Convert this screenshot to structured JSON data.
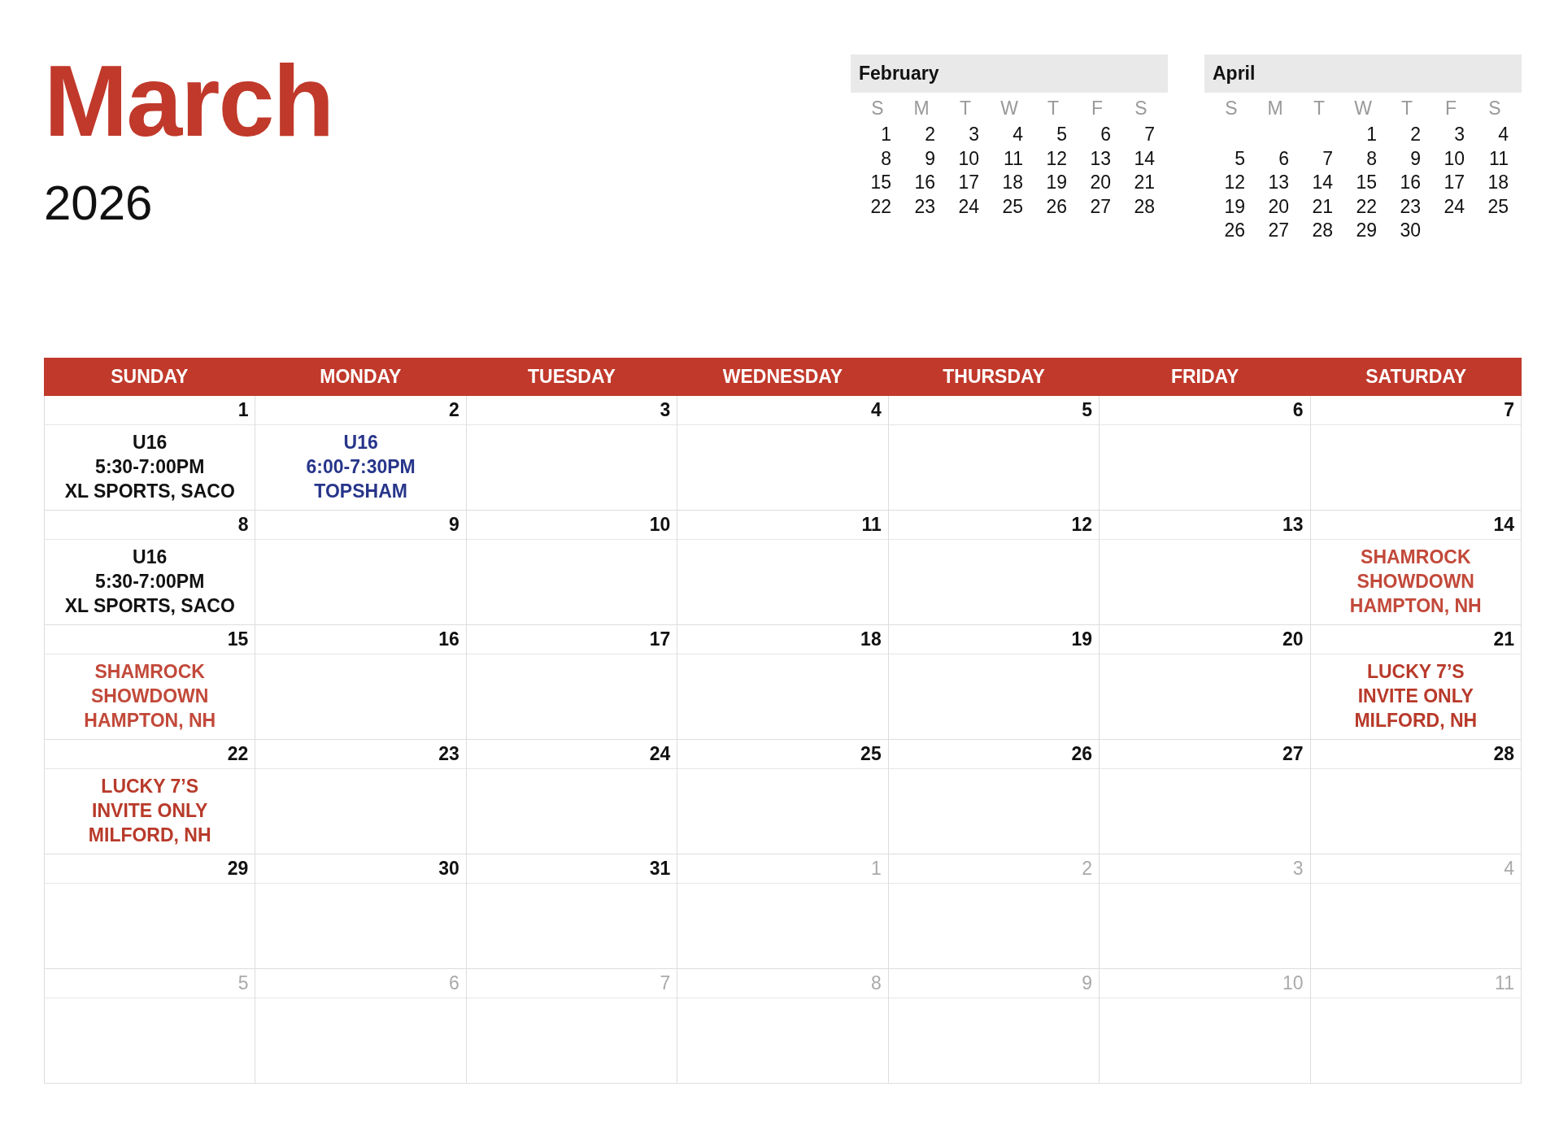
{
  "title": {
    "month": "March",
    "year": "2026"
  },
  "mini_calendars": [
    {
      "month": "February",
      "weekdays": [
        "S",
        "M",
        "T",
        "W",
        "T",
        "F",
        "S"
      ],
      "weeks": [
        [
          "1",
          "2",
          "3",
          "4",
          "5",
          "6",
          "7"
        ],
        [
          "8",
          "9",
          "10",
          "11",
          "12",
          "13",
          "14"
        ],
        [
          "15",
          "16",
          "17",
          "18",
          "19",
          "20",
          "21"
        ],
        [
          "22",
          "23",
          "24",
          "25",
          "26",
          "27",
          "28"
        ]
      ]
    },
    {
      "month": "April",
      "weekdays": [
        "S",
        "M",
        "T",
        "W",
        "T",
        "F",
        "S"
      ],
      "weeks": [
        [
          "1",
          "2",
          "3",
          "4"
        ],
        [
          "5",
          "6",
          "7",
          "8",
          "9",
          "10",
          "11"
        ],
        [
          "12",
          "13",
          "14",
          "15",
          "16",
          "17",
          "18"
        ],
        [
          "19",
          "20",
          "21",
          "22",
          "23",
          "24",
          "25"
        ],
        [
          "26",
          "27",
          "28",
          "29",
          "30"
        ]
      ]
    }
  ],
  "calendar": {
    "weekdays": [
      "SUNDAY",
      "MONDAY",
      "TUESDAY",
      "WEDNESDAY",
      "THURSDAY",
      "FRIDAY",
      "SATURDAY"
    ],
    "weeks": [
      [
        {
          "day": "1",
          "other_month": false,
          "events": [
            {
              "lines": [
                "U16",
                "5:30-7:00PM",
                "XL SPORTS, SACO"
              ],
              "color": "#111111"
            }
          ]
        },
        {
          "day": "2",
          "other_month": false,
          "events": [
            {
              "lines": [
                "U16",
                "6:00-7:30PM",
                "TOPSHAM"
              ],
              "color": "#27358a"
            }
          ]
        },
        {
          "day": "3",
          "other_month": false
        },
        {
          "day": "4",
          "other_month": false
        },
        {
          "day": "5",
          "other_month": false
        },
        {
          "day": "6",
          "other_month": false
        },
        {
          "day": "7",
          "other_month": false
        }
      ],
      [
        {
          "day": "8",
          "other_month": false,
          "events": [
            {
              "lines": [
                "U16",
                "5:30-7:00PM",
                "XL SPORTS, SACO"
              ],
              "color": "#111111"
            }
          ]
        },
        {
          "day": "9",
          "other_month": false
        },
        {
          "day": "10",
          "other_month": false
        },
        {
          "day": "11",
          "other_month": false
        },
        {
          "day": "12",
          "other_month": false
        },
        {
          "day": "13",
          "other_month": false
        },
        {
          "day": "14",
          "other_month": false,
          "events": [
            {
              "lines": [
                "SHAMROCK",
                "SHOWDOWN",
                "HAMPTON, NH"
              ],
              "color": "#c2493a"
            }
          ]
        }
      ],
      [
        {
          "day": "15",
          "other_month": false,
          "events": [
            {
              "lines": [
                "SHAMROCK",
                "SHOWDOWN",
                "HAMPTON, NH"
              ],
              "color": "#c2493a"
            }
          ]
        },
        {
          "day": "16",
          "other_month": false
        },
        {
          "day": "17",
          "other_month": false
        },
        {
          "day": "18",
          "other_month": false
        },
        {
          "day": "19",
          "other_month": false
        },
        {
          "day": "20",
          "other_month": false
        },
        {
          "day": "21",
          "other_month": false,
          "events": [
            {
              "lines": [
                "LUCKY 7’S",
                "INVITE ONLY",
                "MILFORD, NH"
              ],
              "color": "#b83a2a"
            }
          ]
        }
      ],
      [
        {
          "day": "22",
          "other_month": false,
          "events": [
            {
              "lines": [
                "LUCKY 7’S",
                "INVITE ONLY",
                "MILFORD, NH"
              ],
              "color": "#b83a2a"
            }
          ]
        },
        {
          "day": "23",
          "other_month": false
        },
        {
          "day": "24",
          "other_month": false
        },
        {
          "day": "25",
          "other_month": false
        },
        {
          "day": "26",
          "other_month": false
        },
        {
          "day": "27",
          "other_month": false
        },
        {
          "day": "28",
          "other_month": false
        }
      ],
      [
        {
          "day": "29",
          "other_month": false
        },
        {
          "day": "30",
          "other_month": false
        },
        {
          "day": "31",
          "other_month": false
        },
        {
          "day": "1",
          "other_month": true
        },
        {
          "day": "2",
          "other_month": true
        },
        {
          "day": "3",
          "other_month": true
        },
        {
          "day": "4",
          "other_month": true
        }
      ],
      [
        {
          "day": "5",
          "other_month": true
        },
        {
          "day": "6",
          "other_month": true
        },
        {
          "day": "7",
          "other_month": true
        },
        {
          "day": "8",
          "other_month": true
        },
        {
          "day": "9",
          "other_month": true
        },
        {
          "day": "10",
          "other_month": true
        },
        {
          "day": "11",
          "other_month": true
        }
      ]
    ]
  }
}
